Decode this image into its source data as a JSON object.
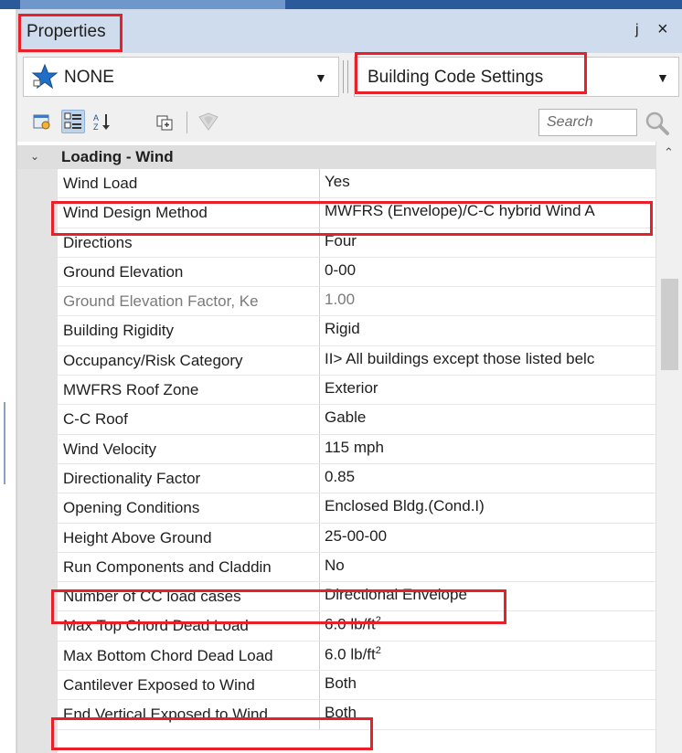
{
  "panel": {
    "title": "Properties",
    "pin_glyph": "ј",
    "close_glyph": "×"
  },
  "object_selector": {
    "value": "NONE",
    "icon": "blue-star-icon"
  },
  "settings_selector": {
    "value": "Building Code Settings"
  },
  "toolbar": {
    "search_placeholder": "Search",
    "buttons": [
      {
        "name": "property-pages-icon"
      },
      {
        "name": "categorized-view-icon"
      },
      {
        "name": "alphabetical-sort-icon"
      },
      {
        "name": "expand-all-icon"
      },
      {
        "name": "disabled-shield-icon"
      }
    ]
  },
  "category": {
    "label": "Loading - Wind"
  },
  "rows": [
    {
      "name": "Wind Load",
      "value": "Yes"
    },
    {
      "name": "Wind Design Method",
      "value": "MWFRS (Envelope)/C-C hybrid Wind A"
    },
    {
      "name": "Directions",
      "value": "Four"
    },
    {
      "name": "Ground Elevation",
      "value": "0-00"
    },
    {
      "name": "Ground Elevation Factor, Ke",
      "value": "1.00"
    },
    {
      "name": "Building Rigidity",
      "value": "Rigid"
    },
    {
      "name": "Occupancy/Risk Category",
      "value": "II> All buildings except those listed belc"
    },
    {
      "name": "MWFRS Roof Zone",
      "value": "Exterior"
    },
    {
      "name": "C-C Roof",
      "value": "Gable"
    },
    {
      "name": "Wind Velocity",
      "value": "115 mph"
    },
    {
      "name": "Directionality Factor",
      "value": "0.85"
    },
    {
      "name": "Opening Conditions",
      "value": "Enclosed Bldg.(Cond.I)"
    },
    {
      "name": "Height Above Ground",
      "value": "25-00-00"
    },
    {
      "name": "Run Components and Claddin",
      "value": "No"
    },
    {
      "name": "Number of CC load cases",
      "value": "Directional Envelope"
    },
    {
      "name": "Max Top Chord Dead Load",
      "value": "6.0 lb/ft",
      "unit_sup": "2"
    },
    {
      "name": "Max Bottom Chord Dead Load",
      "value": "6.0 lb/ft",
      "unit_sup": "2"
    },
    {
      "name": "Cantilever Exposed to Wind",
      "value": "Both"
    },
    {
      "name": "End Vertical Exposed to Wind",
      "value": "Both"
    }
  ],
  "colors": {
    "highlight": "#e8202a",
    "title_bar": "#cfdcee",
    "accent": "#2a5a9a"
  }
}
